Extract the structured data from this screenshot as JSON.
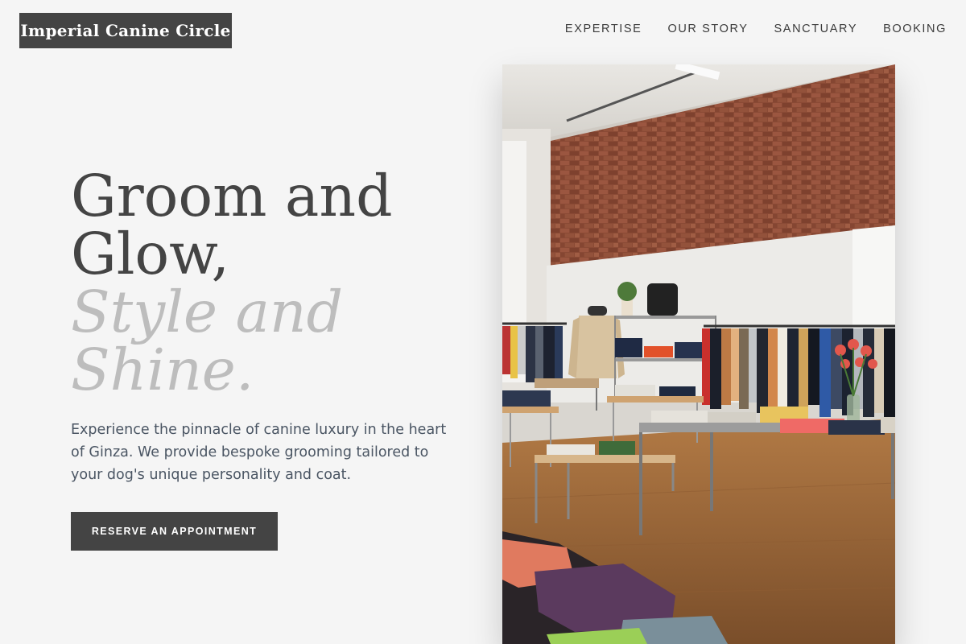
{
  "header": {
    "logo_text": "Imperial Canine Circle",
    "nav": [
      {
        "label": "EXPERTISE"
      },
      {
        "label": "OUR STORY"
      },
      {
        "label": "SANCTUARY"
      },
      {
        "label": "BOOKING"
      }
    ]
  },
  "hero": {
    "title_line1": "Groom and",
    "title_line2": "Glow,",
    "title_line3": "Style and",
    "title_line4": "Shine.",
    "description": "Experience the pinnacle of canine luxury in the heart of Ginza. We provide bespoke grooming tailored to your dog's unique personality and coat.",
    "cta_label": "RESERVE AN APPOINTMENT"
  },
  "colors": {
    "background": "#f5f5f5",
    "primary_dark": "#444444",
    "accent_muted": "#bdbdbd",
    "body_text": "#4a5563"
  }
}
